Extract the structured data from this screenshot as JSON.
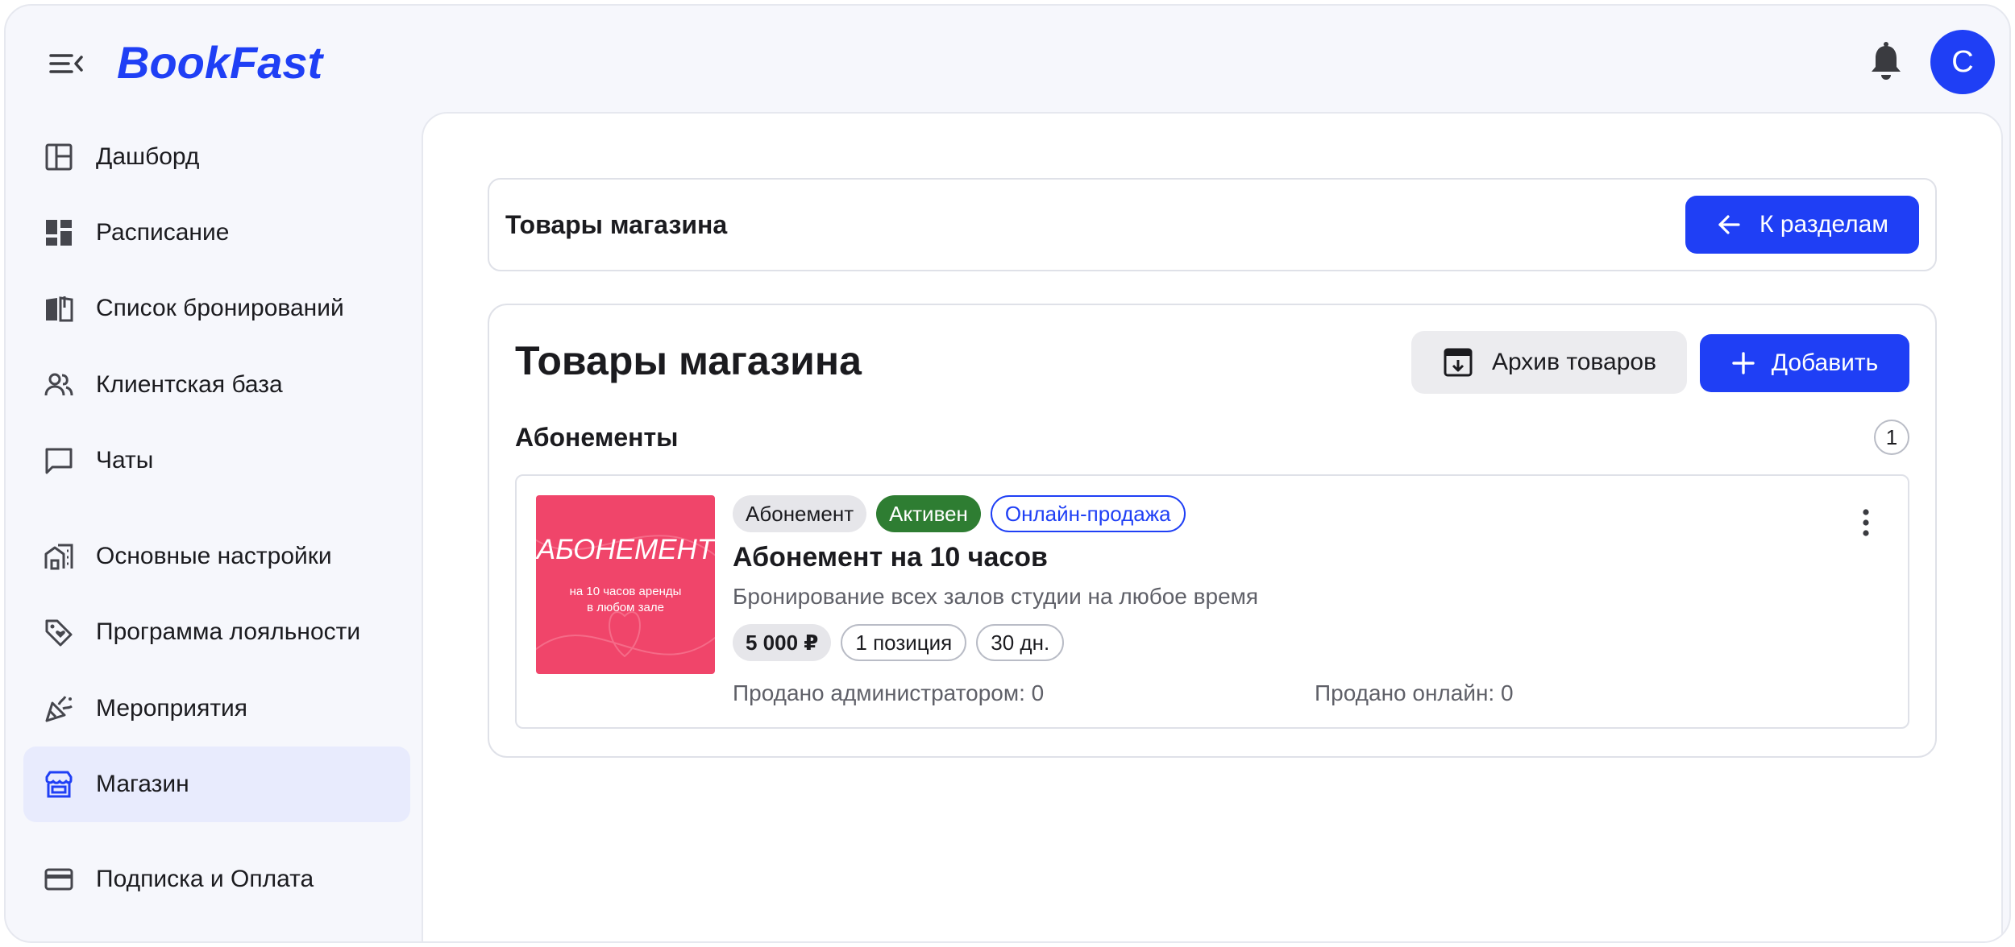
{
  "brand": {
    "name": "BookFast",
    "color": "#1f3ff5"
  },
  "user": {
    "avatar_initial": "С"
  },
  "sidebar": {
    "items": [
      {
        "label": "Дашборд",
        "icon": "dashboard-icon"
      },
      {
        "label": "Расписание",
        "icon": "schedule-icon"
      },
      {
        "label": "Список бронирований",
        "icon": "bookings-icon"
      },
      {
        "label": "Клиентская база",
        "icon": "clients-icon"
      },
      {
        "label": "Чаты",
        "icon": "chat-icon"
      },
      {
        "label": "Основные настройки",
        "icon": "settings-building-icon"
      },
      {
        "label": "Программа лояльности",
        "icon": "loyalty-tag-icon"
      },
      {
        "label": "Мероприятия",
        "icon": "party-icon"
      },
      {
        "label": "Магазин",
        "icon": "store-icon",
        "active": true
      },
      {
        "label": "Подписка и Оплата",
        "icon": "credit-card-icon"
      }
    ]
  },
  "header": {
    "title": "Товары магазина",
    "back_label": "К разделам"
  },
  "products": {
    "title": "Товары магазина",
    "archive_label": "Архив товаров",
    "add_label": "Добавить",
    "section_title": "Абонементы",
    "section_count": "1",
    "item": {
      "thumb_title": "АБОНЕМЕНТ",
      "thumb_subtitle_line1": "на 10 часов аренды",
      "thumb_subtitle_line2": "в любом зале",
      "tag_type": "Абонемент",
      "tag_status": "Активен",
      "tag_channel": "Онлайн-продажа",
      "name": "Абонемент на 10 часов",
      "description": "Бронирование всех залов студии на любое время",
      "price": "5 000 ₽",
      "positions": "1 позиция",
      "duration": "30 дн.",
      "sold_admin": "Продано администратором: 0",
      "sold_online": "Продано онлайн: 0"
    }
  },
  "colors": {
    "accent": "#1f3ff5",
    "status_active": "#2e7d32",
    "thumb_bg": "#f0456a"
  }
}
